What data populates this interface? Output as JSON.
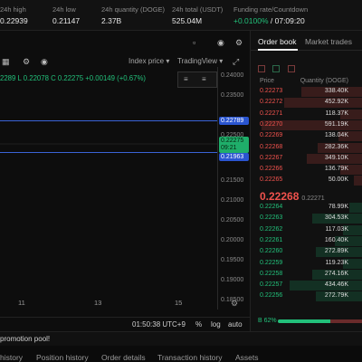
{
  "stats": [
    {
      "label": "24h high",
      "value": "0.22939"
    },
    {
      "label": "24h low",
      "value": "0.21147"
    },
    {
      "label": "24h quantity (DOGE)",
      "value": "2.37B"
    },
    {
      "label": "24h total (USDT)",
      "value": "525.04M"
    },
    {
      "label": "Funding rate/Countdown",
      "value_pos": "+0.0100%",
      "value_rest": " / 07:09:20"
    }
  ],
  "chart": {
    "toolbar_icons": [
      "calendar-icon",
      "gear-icon",
      "camera-icon",
      "bell-icon",
      "settings-icon",
      "expand-icon"
    ],
    "index_price_label": "Index price ▾",
    "tradingview_label": "TradingView ▾",
    "ohlc_text": "2289  L 0.22078  C 0.22275  +0.00149 (+0.67%)",
    "y_ticks": [
      "0.24000",
      "0.23500",
      "0.23000",
      "0.22500",
      "0.22000",
      "0.21500",
      "0.21000",
      "0.20500",
      "0.20000",
      "0.19500",
      "0.19000",
      "0.18500"
    ],
    "labels": {
      "upper": "0.22789",
      "current": "0.22275",
      "countdown": "09:21",
      "lower": "0.21963"
    },
    "x_ticks": [
      "11",
      "13",
      "15"
    ],
    "clock": "01:50:38 UTC+9",
    "pct": "%",
    "log": "log",
    "auto": "auto"
  },
  "orderbook": {
    "tab_active": "Order book",
    "tab_inactive": "Market trades",
    "col_price": "Price",
    "col_qty": "Quantity (DOGE)",
    "asks": [
      {
        "p": "0.22273",
        "q": "338.40K",
        "d": 0.55
      },
      {
        "p": "0.22272",
        "q": "452.92K",
        "d": 0.7
      },
      {
        "p": "0.22271",
        "q": "118.37K",
        "d": 0.2
      },
      {
        "p": "0.22270",
        "q": "591.19K",
        "d": 0.9
      },
      {
        "p": "0.22269",
        "q": "138.04K",
        "d": 0.22
      },
      {
        "p": "0.22268",
        "q": "282.36K",
        "d": 0.4
      },
      {
        "p": "0.22267",
        "q": "349.10K",
        "d": 0.5
      },
      {
        "p": "0.22266",
        "q": "136.79K",
        "d": 0.2
      },
      {
        "p": "0.22265",
        "q": "50.00K",
        "d": 0.08
      }
    ],
    "mid_price": "0.22268",
    "mid_sub": "0.22271",
    "bids": [
      {
        "p": "0.22264",
        "q": "78.99K",
        "d": 0.12
      },
      {
        "p": "0.22263",
        "q": "304.53K",
        "d": 0.45
      },
      {
        "p": "0.22262",
        "q": "117.03K",
        "d": 0.18
      },
      {
        "p": "0.22261",
        "q": "160.40K",
        "d": 0.25
      },
      {
        "p": "0.22260",
        "q": "272.89K",
        "d": 0.42
      },
      {
        "p": "0.22259",
        "q": "119.23K",
        "d": 0.18
      },
      {
        "p": "0.22258",
        "q": "274.16K",
        "d": 0.45
      },
      {
        "p": "0.22257",
        "q": "434.46K",
        "d": 0.65
      },
      {
        "p": "0.22256",
        "q": "272.79K",
        "d": 0.42
      }
    ],
    "ratio_label": "B 62%",
    "ratio_value": 0.62
  },
  "promo": "promotion pool!",
  "bottom_tabs": [
    "history",
    "Position history",
    "Order details",
    "Transaction history",
    "Assets"
  ]
}
